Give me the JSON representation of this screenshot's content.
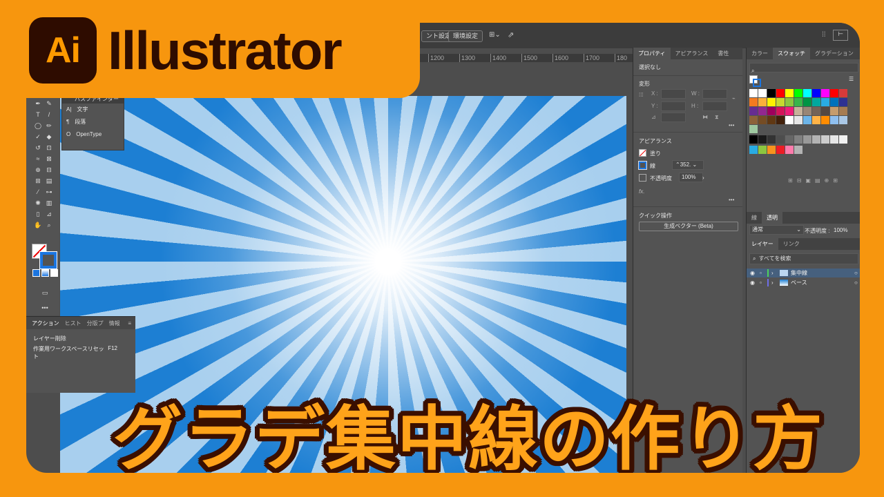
{
  "app": {
    "logo_text": "Ai",
    "name": "Illustrator"
  },
  "headline": "グラデ集中線の作り方",
  "topbar": {
    "btn_doc_setup": "ント設定",
    "btn_prefs": "環境設定"
  },
  "ruler": {
    "ticks": [
      "1200",
      "1300",
      "1400",
      "1500",
      "1600",
      "1700",
      "180"
    ]
  },
  "flyout": {
    "title": "パスファインダー",
    "items": [
      "文字",
      "段落",
      "OpenType"
    ]
  },
  "actions_panel": {
    "tabs": [
      "アクション",
      "ヒスト",
      "分版プ",
      "情報"
    ],
    "rows": [
      {
        "label": "レイヤー削除",
        "key": ""
      },
      {
        "label": "作業用ワークスペースリセット",
        "key": "F12"
      }
    ]
  },
  "properties_panel": {
    "tabs": [
      "プロパティ",
      "アピアランス",
      "書性"
    ],
    "selection": "選択なし",
    "transform_title": "変形",
    "x_label": "X :",
    "y_label": "Y :",
    "w_label": "W :",
    "h_label": "H :",
    "appearance_title": "アピアランス",
    "fill_label": "塗り",
    "stroke_label": "線",
    "stroke_value": "352.",
    "opacity_label": "不透明度",
    "opacity_value": "100%",
    "fx_label": "fx.",
    "quick_actions_title": "クイック操作",
    "vector_button": "生成ベクター (Beta)"
  },
  "swatches_panel": {
    "tabs": [
      "カラー",
      "スウォッチ",
      "グラデーション"
    ],
    "rows": [
      [
        "#ffffff",
        "#ffffff",
        "#000000",
        "#ff0000",
        "#ffff00",
        "#00ff00",
        "#00ffff",
        "#0000ff",
        "#ff00ff",
        "#ff0000",
        "#d63a3a"
      ],
      [
        "#f47b20",
        "#fbb03b",
        "#fff200",
        "#c6d92f",
        "#8cc63f",
        "#39b54a",
        "#009444",
        "#00a99d",
        "#29abe2",
        "#0071bc",
        "#2e3192"
      ],
      [
        "#662d91",
        "#92278f",
        "#9e005d",
        "#d4145a",
        "#ed1e79",
        "#c7b299",
        "#998675",
        "#736357",
        "#534741",
        "#c69c6d",
        "#a67c52"
      ],
      [
        "#8c6239",
        "#754c24",
        "#603813",
        "#42210b",
        "#ffffff",
        "#e6e6e6",
        "#6cb4e8",
        "#ffb347",
        "#ff8c00",
        "#8fbfef",
        "#aac8e6"
      ],
      [
        "#9ec8a0"
      ],
      [
        "#000000",
        "#1a1a1a",
        "#333333",
        "#4d4d4d",
        "#666666",
        "#808080",
        "#999999",
        "#b3b3b3",
        "#cccccc",
        "#e6e6e6",
        "#f2f2f2"
      ],
      [
        "#29abe2",
        "#8cc63f",
        "#f7931e",
        "#ed1c24",
        "#ff7bac",
        "#b3b3b3"
      ]
    ]
  },
  "transparency_panel": {
    "tabs": [
      "線",
      "透明"
    ],
    "blend_mode": "通常",
    "opacity_label": "不透明度 :",
    "opacity_value": "100%"
  },
  "layers_panel": {
    "tabs": [
      "レイヤー",
      "リンク"
    ],
    "search_placeholder": "すべてを検索",
    "layers": [
      {
        "name": "集中線",
        "color": "#4ed25a"
      },
      {
        "name": "ベース",
        "color": "#6e6ee8"
      }
    ]
  }
}
